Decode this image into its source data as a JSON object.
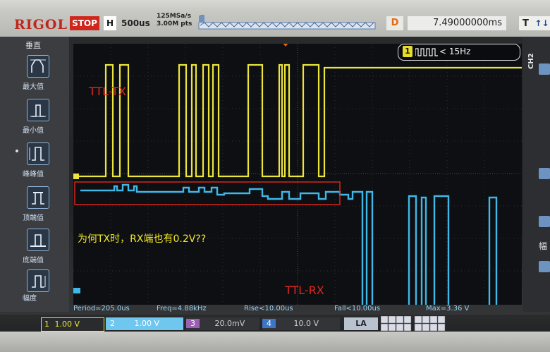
{
  "header": {
    "brand": "RIGOL",
    "run_state": "STOP",
    "timebase_label": "H",
    "timebase_value": "500us",
    "sample_rate": "125MSa/s",
    "memory_depth": "3.00M pts",
    "delay_label": "D",
    "delay_value": "7.49000000ms",
    "trigger_label": "T",
    "trigger_icon": "rising-falling-edge-icon"
  },
  "left_menu": {
    "title": "垂直",
    "items": [
      {
        "label": "最大值",
        "icon": "max-value-icon"
      },
      {
        "label": "最小值",
        "icon": "min-value-icon"
      },
      {
        "label": "峰峰值",
        "icon": "peak-to-peak-icon"
      },
      {
        "label": "顶端值",
        "icon": "top-value-icon"
      },
      {
        "label": "底端值",
        "icon": "base-value-icon"
      },
      {
        "label": "幅度",
        "icon": "amplitude-icon"
      }
    ]
  },
  "right_panel": {
    "channel_tab": "CH2",
    "side_text": "幅"
  },
  "frequency_counter": {
    "channel": "1",
    "value": "< 15Hz"
  },
  "annotations": {
    "tx_label": "TTL-TX",
    "rx_label": "TTL-RX",
    "question": "为何TX时，RX端也有0.2V??"
  },
  "measurements": {
    "period": "Period=205.0us",
    "freq": "Freq=4.88kHz",
    "rise": "Rise<10.00us",
    "fall": "Fall<10.00us",
    "max": "Max=3.36 V"
  },
  "channels": [
    {
      "number": "1",
      "scale": "1.00 V"
    },
    {
      "number": "2",
      "scale": "1.00 V"
    },
    {
      "number": "3",
      "scale": "20.0mV"
    },
    {
      "number": "4",
      "scale": "10.0 V"
    }
  ],
  "la_label": "LA",
  "colors": {
    "ch1": "#ece63a",
    "ch2": "#3fb8e8",
    "annotation_red": "#e3271b",
    "annotation_yellow": "#f2e82a",
    "brand_red": "#c0261c",
    "delay_orange": "#e46a10"
  }
}
